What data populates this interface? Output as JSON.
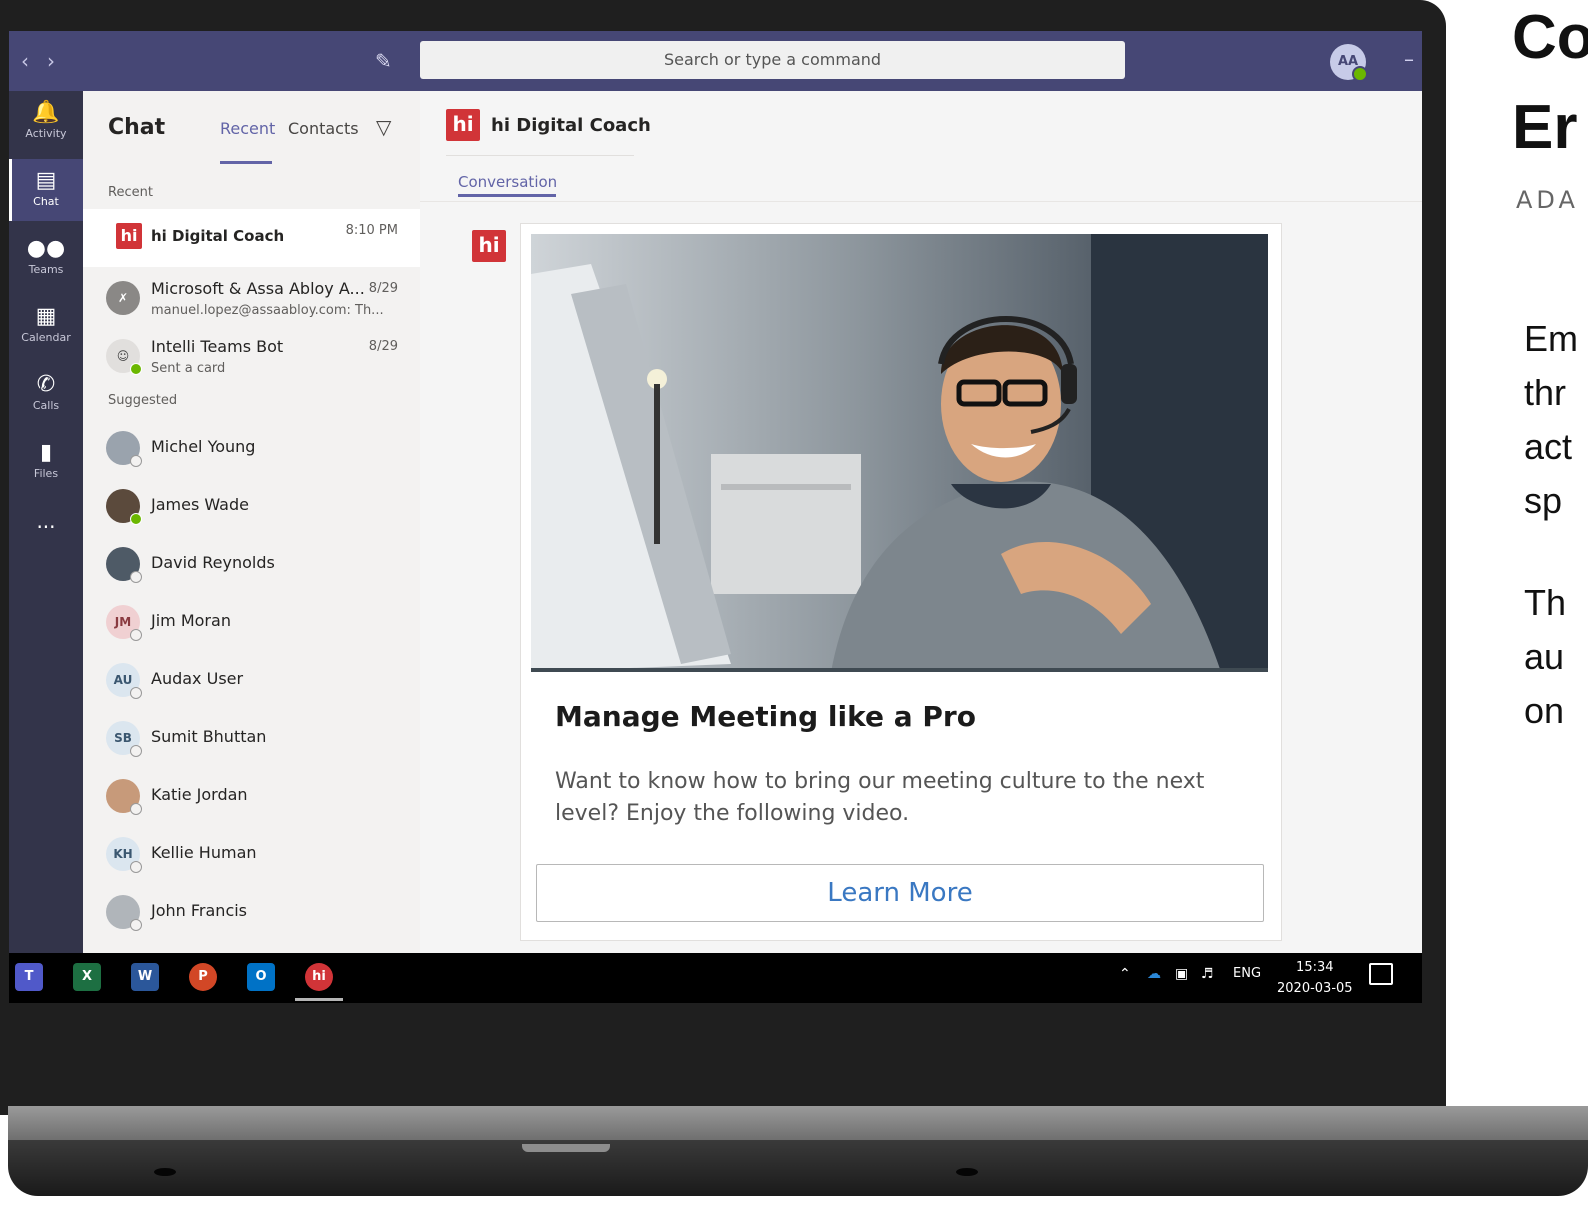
{
  "topbar": {
    "search_placeholder": "Search or type a command",
    "user_initials": "AA"
  },
  "rail": {
    "items": [
      {
        "label": "Activity",
        "icon": "bell-icon"
      },
      {
        "label": "Chat",
        "icon": "chat-icon"
      },
      {
        "label": "Teams",
        "icon": "teams-icon"
      },
      {
        "label": "Calendar",
        "icon": "calendar-icon"
      },
      {
        "label": "Calls",
        "icon": "phone-icon"
      },
      {
        "label": "Files",
        "icon": "file-icon"
      }
    ],
    "more": "..."
  },
  "chatpane": {
    "title": "Chat",
    "tab_recent": "Recent",
    "tab_contacts": "Contacts",
    "section_recent": "Recent",
    "section_suggested": "Suggested",
    "recent": [
      {
        "name": "hi Digital Coach",
        "badge": "hi",
        "time": "8:10 PM",
        "sub": ""
      },
      {
        "name": "Microsoft & Assa Abloy A...",
        "badge": "",
        "time": "8/29",
        "sub": "manuel.lopez@assaabloy.com: Th..."
      },
      {
        "name": "Intelli Teams Bot",
        "badge": "",
        "time": "8/29",
        "sub": "Sent a card"
      }
    ],
    "suggested": [
      {
        "name": "Michel Young",
        "initials": ""
      },
      {
        "name": "James Wade",
        "initials": ""
      },
      {
        "name": "David Reynolds",
        "initials": ""
      },
      {
        "name": "Jim Moran",
        "initials": "JM"
      },
      {
        "name": "Audax User",
        "initials": "AU"
      },
      {
        "name": "Sumit Bhuttan",
        "initials": "SB"
      },
      {
        "name": "Katie Jordan",
        "initials": ""
      },
      {
        "name": "Kellie Human",
        "initials": "KH"
      },
      {
        "name": "John Francis",
        "initials": ""
      }
    ]
  },
  "main": {
    "badge": "hi",
    "title": "hi Digital Coach",
    "tab": "Conversation",
    "card": {
      "title": "Manage Meeting like a Pro",
      "body": "Want to know how to bring our meeting culture to the next level? Enjoy the following video.",
      "button": "Learn More"
    }
  },
  "taskbar": {
    "apps": [
      {
        "name": "teams",
        "label": "T",
        "color": "#5059c9"
      },
      {
        "name": "excel",
        "label": "X",
        "color": "#1d6f42"
      },
      {
        "name": "word",
        "label": "W",
        "color": "#2b579a"
      },
      {
        "name": "powerpoint",
        "label": "P",
        "color": "#d24726"
      },
      {
        "name": "outlook",
        "label": "O",
        "color": "#0072c6"
      },
      {
        "name": "hi",
        "label": "hi",
        "color": "#d13438"
      }
    ],
    "lang": "ENG",
    "time": "15:34",
    "date": "2020-03-05"
  },
  "side_panel": {
    "heading_1": "Co",
    "heading_2": "Er",
    "subtitle": "ADA",
    "paragraph_1": [
      "Em",
      "thr",
      "act",
      "sp"
    ],
    "paragraph_2": [
      "Th",
      "au",
      "on"
    ]
  },
  "colors": {
    "teams_purple": "#464775",
    "accent": "#6264a7",
    "hi_red": "#d13438",
    "link_blue": "#3a78c2"
  }
}
